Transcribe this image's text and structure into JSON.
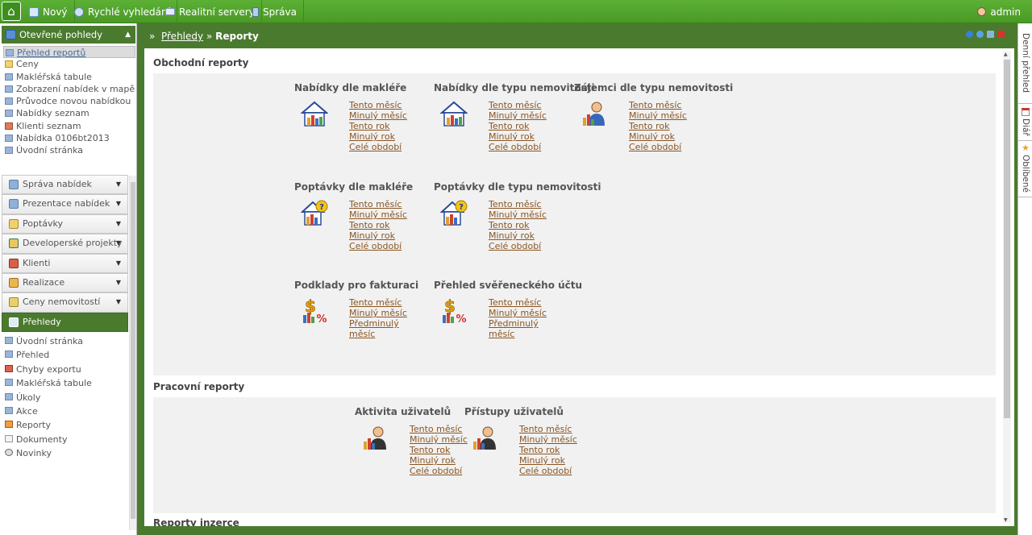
{
  "topbar": {
    "menu": [
      {
        "label": "Nový",
        "icon": "new-icon"
      },
      {
        "label": "Rychlé vyhledání",
        "icon": "search-icon"
      },
      {
        "label": "Realitní servery",
        "icon": "servers-icon"
      },
      {
        "label": "Správa",
        "icon": "admin-icon"
      }
    ],
    "user": "admin"
  },
  "sidebar": {
    "header": "Otevřené pohledy",
    "open_views": [
      "Přehled reportů",
      "Ceny",
      "Makléřská tabule",
      "Zobrazení nabídek v mapě",
      "Průvodce novou nabídkou",
      "Nabídky seznam",
      "Klienti seznam",
      "Nabídka 0106bt2013",
      "Úvodní stránka"
    ],
    "groups": [
      "Správa nabídek",
      "Prezentace nabídek",
      "Poptávky",
      "Developerské projekty",
      "Klienti",
      "Realizace",
      "Ceny nemovitostí",
      "Přehledy"
    ],
    "sub_items": [
      "Úvodní stránka",
      "Přehled",
      "Chyby exportu",
      "Makléřská tabule",
      "Úkoly",
      "Akce",
      "Reporty",
      "Dokumenty",
      "Novinky"
    ]
  },
  "breadcrumb": {
    "prefix": "»",
    "parent": "Přehledy",
    "sep": "»",
    "current": "Reporty"
  },
  "sections": {
    "business": {
      "title": "Obchodní reporty",
      "reports": [
        {
          "title": "Nabídky dle makléře",
          "links": [
            "Tento měsíc",
            "Minulý měsíc",
            "Tento rok",
            "Minulý rok",
            "Celé období"
          ]
        },
        {
          "title": "Nabídky dle typu nemovitosti",
          "links": [
            "Tento měsíc",
            "Minulý měsíc",
            "Tento rok",
            "Minulý rok",
            "Celé období"
          ]
        },
        {
          "title": "Zájemci dle typu nemovitosti",
          "links": [
            "Tento měsíc",
            "Minulý měsíc",
            "Tento rok",
            "Minulý rok",
            "Celé období"
          ]
        },
        {
          "title": "Poptávky dle makléře",
          "links": [
            "Tento měsíc",
            "Minulý měsíc",
            "Tento rok",
            "Minulý rok",
            "Celé období"
          ]
        },
        {
          "title": "Poptávky dle typu nemovitosti",
          "links": [
            "Tento měsíc",
            "Minulý měsíc",
            "Tento rok",
            "Minulý rok",
            "Celé období"
          ]
        },
        {
          "title": "Podklady pro fakturaci",
          "links": [
            "Tento měsíc",
            "Minulý měsíc",
            "Předminulý měsíc"
          ]
        },
        {
          "title": "Přehled svěřeneckého účtu",
          "links": [
            "Tento měsíc",
            "Minulý měsíc",
            "Předminulý měsíc"
          ]
        }
      ]
    },
    "work": {
      "title": "Pracovní reporty",
      "reports": [
        {
          "title": "Aktivita uživatelů",
          "links": [
            "Tento měsíc",
            "Minulý měsíc",
            "Tento rok",
            "Minulý rok",
            "Celé období"
          ]
        },
        {
          "title": "Přístupy uživatelů",
          "links": [
            "Tento měsíc",
            "Minulý měsíc",
            "Tento rok",
            "Minulý rok",
            "Celé období"
          ]
        }
      ]
    },
    "ads": {
      "title": "Reporty inzerce"
    }
  },
  "right_tabs": [
    "Denní přehled",
    "Diář",
    "Oblíbené"
  ]
}
